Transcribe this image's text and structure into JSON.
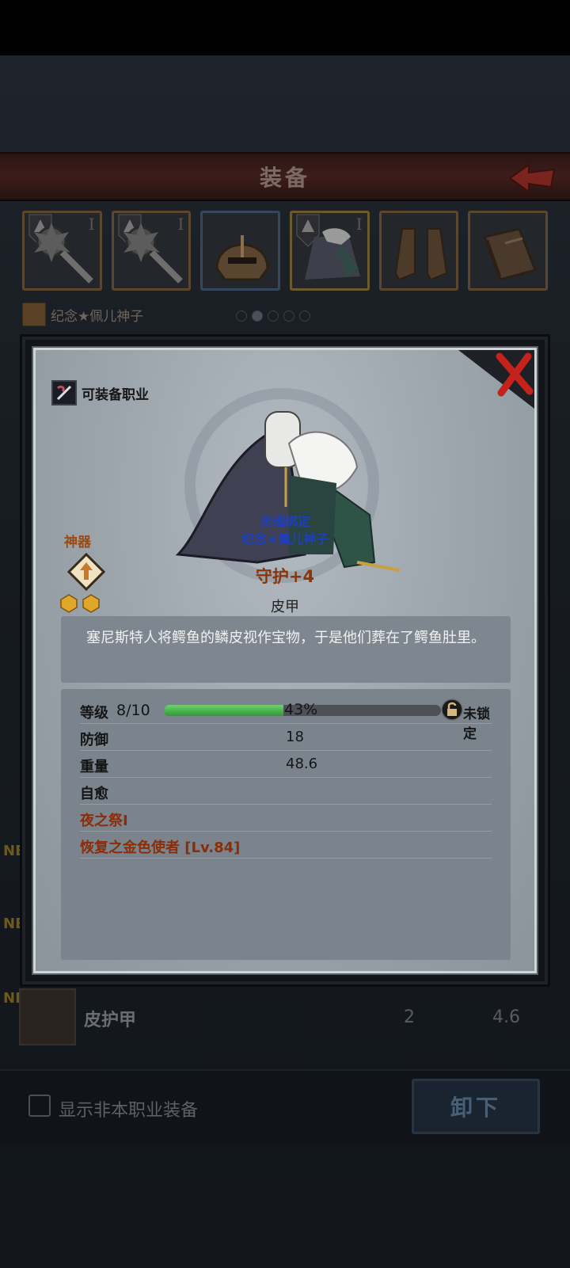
{
  "header": {
    "title": "装备"
  },
  "slots": [
    {
      "name": "weapon-slot-1",
      "roman": "I"
    },
    {
      "name": "weapon-slot-2",
      "roman": "I"
    },
    {
      "name": "helmet-slot",
      "roman": ""
    },
    {
      "name": "armor-slot",
      "roman": "I"
    },
    {
      "name": "boots-slot",
      "roman": ""
    },
    {
      "name": "book-slot",
      "roman": ""
    }
  ],
  "set": {
    "name": "纪念★佩儿神子"
  },
  "modal": {
    "class_label": "可装备职业",
    "artifact_label": "神器",
    "soulbind_line1": "灵魂绑定",
    "soulbind_line2": "纪念★佩儿神子",
    "item_name": "守护+4",
    "item_type": "皮甲",
    "description": "塞尼斯特人将鳄鱼的鳞皮视作宝物，于是他们葬在了鳄鱼肚里。",
    "level_label": "等级",
    "level_value": "8/10",
    "progress_percent": 43,
    "progress_text": "43%",
    "lock_label": "未锁定",
    "stats": [
      {
        "label": "防御",
        "value": "18"
      },
      {
        "label": "重量",
        "value": "48.6"
      },
      {
        "label": "自愈",
        "value": ""
      }
    ],
    "skills": [
      {
        "label": "夜之祭I"
      },
      {
        "label": "恢复之金色使者 [Lv.84]"
      }
    ]
  },
  "list": {
    "new_label": "NEW",
    "row_name": "皮护甲",
    "row_value1": "2",
    "row_value2": "4.6"
  },
  "bottom": {
    "checkbox_label": "显示非本职业装备",
    "unequip_label": "卸下"
  },
  "colors": {
    "progress_fill": "#3fae44",
    "header_bg": "#3d1d1a",
    "soulbind_text": "#1f3fb8",
    "item_name_text": "#8a3408"
  }
}
